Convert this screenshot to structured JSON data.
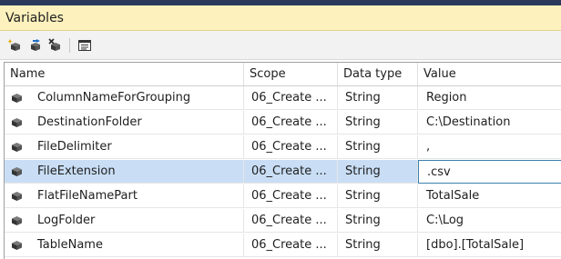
{
  "panel": {
    "title": "Variables"
  },
  "toolbar": {
    "buttons": [
      {
        "name": "add-variable-button",
        "icon": "add-variable-icon"
      },
      {
        "name": "move-variable-button",
        "icon": "move-variable-icon"
      },
      {
        "name": "delete-variable-button",
        "icon": "delete-variable-icon"
      },
      {
        "name": "grid-options-button",
        "icon": "grid-options-icon"
      }
    ]
  },
  "grid": {
    "columns": [
      "Name",
      "Scope",
      "Data type",
      "Value"
    ],
    "rows": [
      {
        "name": "ColumnNameForGrouping",
        "scope": "06_Create ...",
        "type": "String",
        "value": "Region"
      },
      {
        "name": "DestinationFolder",
        "scope": "06_Create ...",
        "type": "String",
        "value": "C:\\Destination"
      },
      {
        "name": "FileDelimiter",
        "scope": "06_Create ...",
        "type": "String",
        "value": ","
      },
      {
        "name": "FileExtension",
        "scope": "06_Create ...",
        "type": "String",
        "value": ".csv",
        "selected": true
      },
      {
        "name": "FlatFileNamePart",
        "scope": "06_Create ...",
        "type": "String",
        "value": "TotalSale"
      },
      {
        "name": "LogFolder",
        "scope": "06_Create ...",
        "type": "String",
        "value": "C:\\Log"
      },
      {
        "name": "TableName",
        "scope": "06_Create ...",
        "type": "String",
        "value": "[dbo].[TotalSale]"
      }
    ]
  },
  "colors": {
    "title_bg": "#fdf1bd",
    "selected_row_bg": "#c9def5",
    "edit_border": "#3c7fb1"
  }
}
